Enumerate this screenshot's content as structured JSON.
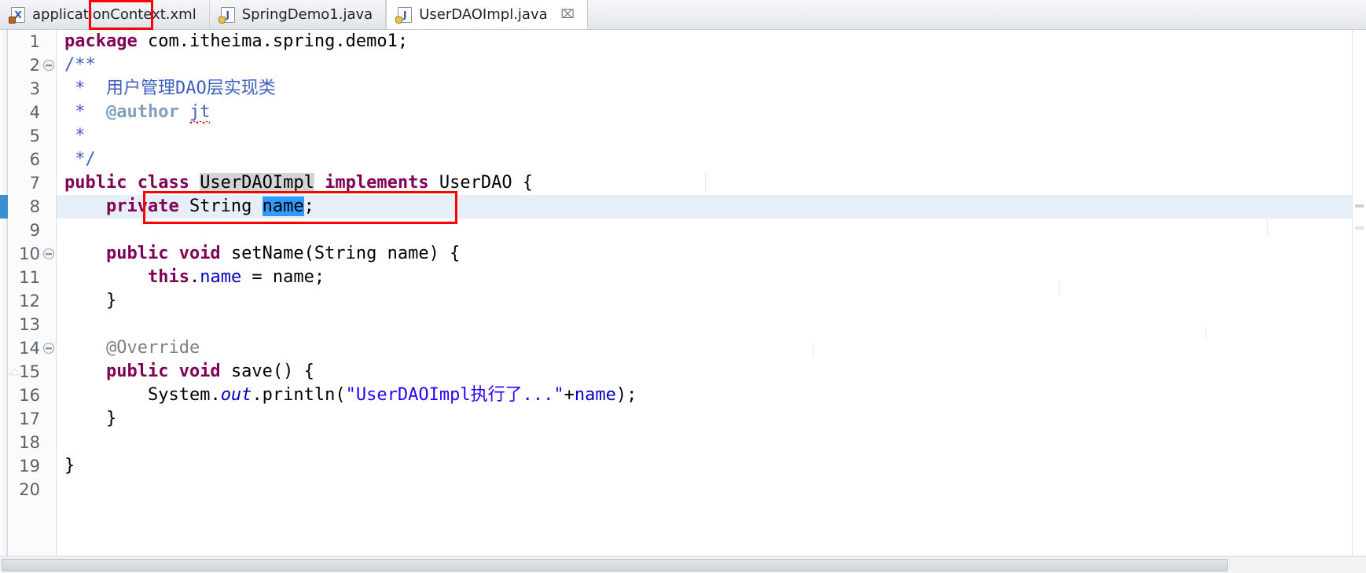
{
  "window": {
    "kind": "eclipse-java-editor"
  },
  "tabs": [
    {
      "label": "applicationContext.xml",
      "icon": "xml-file-icon",
      "icon_letter": "X",
      "active": false,
      "closable": false
    },
    {
      "label": "SpringDemo1.java",
      "icon": "java-file-icon",
      "icon_letter": "J",
      "active": false,
      "closable": false
    },
    {
      "label": "UserDAOImpl.java",
      "icon": "java-file-icon",
      "icon_letter": "J",
      "active": true,
      "closable": true,
      "close_glyph": "⌧"
    }
  ],
  "annotations": {
    "color": "#ff0000",
    "tab_highlight": {
      "target": "tab-UserDAOImpl.java"
    },
    "code_highlight": {
      "target": "line-8"
    }
  },
  "gutter": {
    "lines": [
      {
        "n": "1",
        "fold": false,
        "override": false
      },
      {
        "n": "2",
        "fold": true,
        "override": false
      },
      {
        "n": "3",
        "fold": false,
        "override": false
      },
      {
        "n": "4",
        "fold": false,
        "override": false
      },
      {
        "n": "5",
        "fold": false,
        "override": false
      },
      {
        "n": "6",
        "fold": false,
        "override": false
      },
      {
        "n": "7",
        "fold": false,
        "override": false
      },
      {
        "n": "8",
        "fold": false,
        "override": false
      },
      {
        "n": "9",
        "fold": false,
        "override": false
      },
      {
        "n": "10",
        "fold": true,
        "override": false
      },
      {
        "n": "11",
        "fold": false,
        "override": false
      },
      {
        "n": "12",
        "fold": false,
        "override": false
      },
      {
        "n": "13",
        "fold": false,
        "override": false
      },
      {
        "n": "14",
        "fold": true,
        "override": false
      },
      {
        "n": "15",
        "fold": false,
        "override": true
      },
      {
        "n": "16",
        "fold": false,
        "override": false
      },
      {
        "n": "17",
        "fold": false,
        "override": false
      },
      {
        "n": "18",
        "fold": false,
        "override": false
      },
      {
        "n": "19",
        "fold": false,
        "override": false
      },
      {
        "n": "20",
        "fold": false,
        "override": false
      }
    ]
  },
  "source": {
    "file_name": "UserDAOImpl.java",
    "current_line": 8,
    "selection": "name",
    "occurrence_highlight": "UserDAOImpl",
    "lines": [
      "package com.itheima.spring.demo1;",
      "/**",
      " *  用户管理DAO层实现类",
      " *  @author jt",
      " *",
      " */",
      "public class UserDAOImpl implements UserDAO {",
      "    private String name;",
      "",
      "    public void setName(String name) {",
      "        this.name = name;",
      "    }",
      "",
      "    @Override",
      "    public void save() {",
      "        System.out.println(\"UserDAOImpl执行了...\"+name);",
      "    }",
      "",
      "}",
      ""
    ]
  },
  "colors": {
    "keyword": "#7f0055",
    "comment": "#3f5fbf",
    "javadoc_tag": "#7f9fbf",
    "string": "#2a00ff",
    "field": "#0000c0",
    "annotation": "#808080",
    "selection": "#3399ff",
    "current_line": "#e6eef8",
    "occurrence": "#d4d4d4",
    "annotation_box": "#ff0000"
  }
}
